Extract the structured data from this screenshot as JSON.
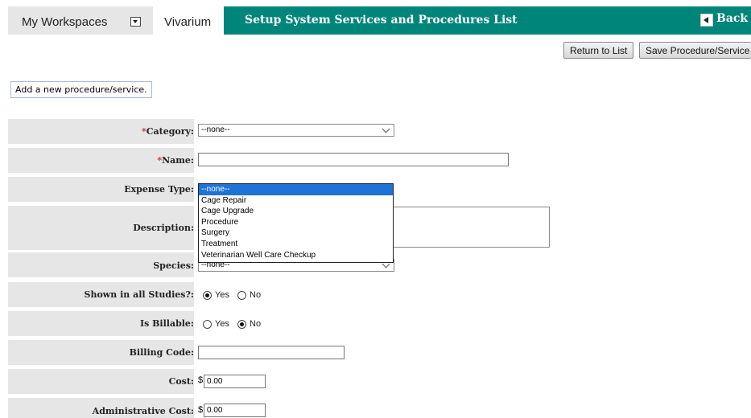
{
  "header": {
    "workspaces_label": "My Workspaces",
    "tab_label": "Vivarium",
    "title": "Setup System Services and Procedures List",
    "back_label": "Back"
  },
  "toolbar": {
    "return_label": "Return to List",
    "save_label": "Save Procedure/Service"
  },
  "note": "Add a new procedure/service.",
  "form": {
    "category": {
      "label": "Category:",
      "required": "*",
      "value": "--none--"
    },
    "name": {
      "label": "Name:",
      "required": "*",
      "value": ""
    },
    "expense_type": {
      "label": "Expense Type:",
      "options": [
        "--none--",
        "Cage Repair",
        "Cage Upgrade",
        "Procedure",
        "Surgery",
        "Treatment",
        "Veterinarian Well Care Checkup"
      ],
      "highlighted": "--none--"
    },
    "description": {
      "label": "Description:"
    },
    "species": {
      "label": "Species:",
      "value": "--none--"
    },
    "shown_in_all_studies": {
      "label": "Shown in all Studies?:",
      "yes": "Yes",
      "no": "No",
      "selected": "Yes"
    },
    "is_billable": {
      "label": "Is Billable:",
      "yes": "Yes",
      "no": "No",
      "selected": "No"
    },
    "billing_code": {
      "label": "Billing Code:",
      "value": ""
    },
    "cost": {
      "label": "Cost:",
      "currency": "$",
      "value": "0.00"
    },
    "admin_cost": {
      "label": "Administrative Cost:",
      "currency": "$",
      "value": "0.00"
    }
  },
  "colors": {
    "accent": "#00857b",
    "label_bg": "#e6e6e6",
    "highlight": "#1e73d8",
    "required": "#c0392b"
  },
  "icons": {
    "workspace_dropdown": "dropdown-box-icon",
    "back": "back-arrow-icon"
  }
}
